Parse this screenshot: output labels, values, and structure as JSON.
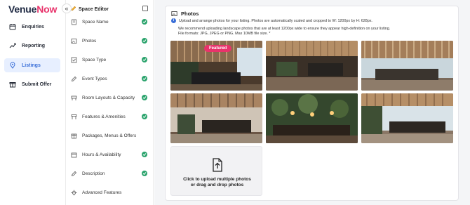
{
  "brand": {
    "part1": "Venue",
    "part2": "Now"
  },
  "collapse_glyph": "«",
  "nav": {
    "items": [
      {
        "label": "Enquiries",
        "icon": "calendar-icon"
      },
      {
        "label": "Reporting",
        "icon": "trend-line-icon"
      },
      {
        "label": "Listings",
        "icon": "location-pin-icon",
        "active": true
      },
      {
        "label": "Submit Offer",
        "icon": "gift-icon"
      }
    ]
  },
  "editor": {
    "title": "Space Editor",
    "items": [
      {
        "label": "Space Name",
        "icon": "document-icon",
        "done": true
      },
      {
        "label": "Photos",
        "icon": "image-icon",
        "done": true
      },
      {
        "label": "Space Type",
        "icon": "checkbox-icon",
        "done": true
      },
      {
        "label": "Event Types",
        "icon": "pencil-icon",
        "done": true
      },
      {
        "label": "Room Layouts & Capacity",
        "icon": "layout-icon",
        "done": true
      },
      {
        "label": "Features & Amenities",
        "icon": "amenities-icon",
        "done": true
      },
      {
        "label": "Packages, Menus & Offers",
        "icon": "gift-icon",
        "done": false
      },
      {
        "label": "Hours & Availability",
        "icon": "calendar-icon",
        "done": true
      },
      {
        "label": "Description",
        "icon": "edit-icon",
        "done": true
      },
      {
        "label": "Advanced Features",
        "icon": "gear-icon",
        "done": false
      }
    ]
  },
  "photos": {
    "title": "Photos",
    "info": "Upload and arrange photos for your listing. Photos are automatically scaled and cropped to W: 1200px by H: 628px.",
    "recommendation": "We recommend uploading landscape photos that are at least 1200px wide to ensure they appear high-definition on your listing. File formats: JPG, JPEG or PNG. Max 10MB file size. *",
    "featured_label": "Featured",
    "upload_label_1": "Click to upload multiple photos",
    "upload_label_2": "or drag and drop photos",
    "colors": {
      "accent": "#e8336b",
      "done": "#2aa36c",
      "active": "#3a6fd8"
    }
  }
}
